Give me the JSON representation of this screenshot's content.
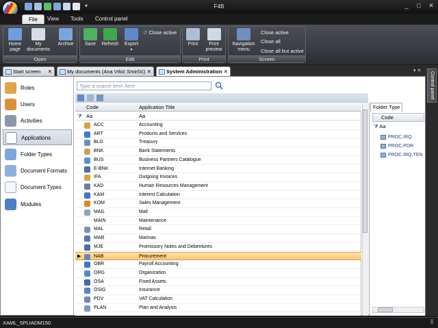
{
  "window": {
    "title": "F4B",
    "controls": [
      "_",
      "□",
      "✕"
    ]
  },
  "ribbon_tabs": [
    "File",
    "View",
    "Tools",
    "Control panel"
  ],
  "ribbon": {
    "open_group": {
      "label": "Open",
      "home": "Home\npage",
      "my_docs": "My\ndocuments",
      "archive": "Archive"
    },
    "edit_group": {
      "label": "Edit",
      "save": "Save",
      "refresh": "Refresh",
      "export": "Export",
      "close_active": "Close active"
    },
    "print_group": {
      "label": "Print",
      "print": "Print",
      "preview": "Print\npreview"
    },
    "screen_group": {
      "label": "Screen",
      "nav_menu": "Navigation\nmenu",
      "close_active": "Close active",
      "close_all": "Close all",
      "close_all_but": "Close all but active"
    }
  },
  "doc_tabs": [
    {
      "label": "Start screen",
      "close": "✕"
    },
    {
      "label": "My documents (Ana Vrkić Smirčić)",
      "close": "✕"
    },
    {
      "label": "System Administration",
      "close": "✕"
    }
  ],
  "nav": [
    "Roles",
    "Users",
    "Activities",
    "Applications",
    "Folder Types",
    "Document Formats",
    "Document Types",
    "Modules"
  ],
  "search": {
    "placeholder": "Type a search term here"
  },
  "grid": {
    "headers": {
      "code": "Code",
      "title": "Application Title"
    },
    "filter": {
      "code": "Aa",
      "title": "Aa"
    },
    "selected_marker": "▶",
    "rows": [
      {
        "code": "ACC",
        "title": "Accounting",
        "color": "#d9a23a"
      },
      {
        "code": "ART",
        "title": "Products and Services",
        "color": "#3a7bd5"
      },
      {
        "code": "BLG",
        "title": "Treasury",
        "color": "#6c8fb9"
      },
      {
        "code": "BNK",
        "title": "Bank Statements",
        "color": "#c7a45b"
      },
      {
        "code": "BUS",
        "title": "Business Partners Catalogue",
        "color": "#5b8fd1"
      },
      {
        "code": "E-BNK",
        "title": "Internet Banking",
        "color": "#4a6fa5"
      },
      {
        "code": "IFA",
        "title": "Outgoing Invoices",
        "color": "#e0a33a"
      },
      {
        "code": "KAD",
        "title": "Human Resources Management",
        "color": "#6b7f9c"
      },
      {
        "code": "KAM",
        "title": "Interest Calculation",
        "color": "#3f77c9"
      },
      {
        "code": "KOM",
        "title": "Sales Management",
        "color": "#d38b2c"
      },
      {
        "code": "MAIL",
        "title": "Mail",
        "color": "#8ea4c2"
      },
      {
        "code": "MAIN",
        "title": "Maintenance",
        "color": "#ffffff"
      },
      {
        "code": "MAL",
        "title": "Retail",
        "color": "#7b95b8"
      },
      {
        "code": "MAR",
        "title": "Marinas",
        "color": "#5a78a8"
      },
      {
        "code": "MJE",
        "title": "Promissory Notes and Debentures",
        "color": "#4a6ea6"
      },
      {
        "code": "NAB",
        "title": "Procurement",
        "color": "#6a88b5"
      },
      {
        "code": "OBR",
        "title": "Payroll Accounting",
        "color": "#3f77c9"
      },
      {
        "code": "ORG",
        "title": "Organization",
        "color": "#4f8ad0"
      },
      {
        "code": "OSA",
        "title": "Fixed Assets",
        "color": "#3f6ea9"
      },
      {
        "code": "OSIG",
        "title": "Insurance",
        "color": "#5a83c0"
      },
      {
        "code": "PDV",
        "title": "VAT Calculation",
        "color": "#6b89b3"
      },
      {
        "code": "PLAN",
        "title": "Plan and Analysis",
        "color": "#7a98c2"
      }
    ],
    "selected_index": 15
  },
  "right_panel": {
    "tab": "Folder Type",
    "header": "Code",
    "filter": "Aa",
    "items": [
      "PROC.IRQ",
      "PROC.POR",
      "PROC.IRQ.TEN"
    ]
  },
  "side_panel": {
    "label": "Control panel"
  },
  "status": {
    "text": "XAML_SPLIADM150",
    "grip": "||"
  }
}
